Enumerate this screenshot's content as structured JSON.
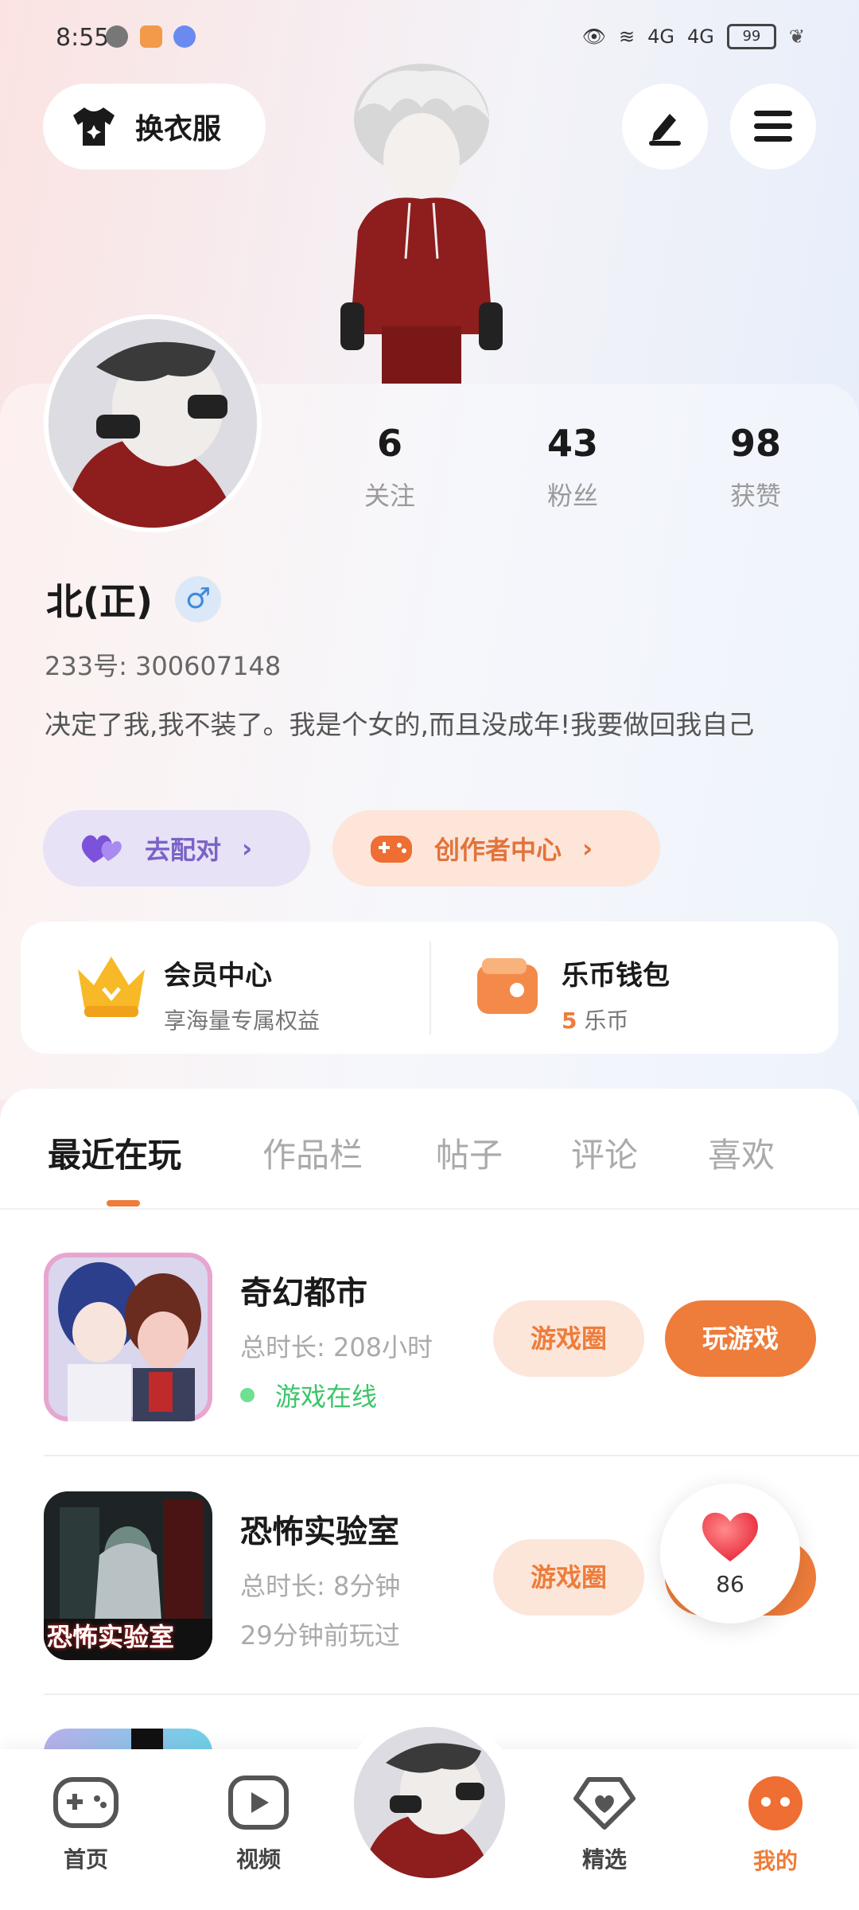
{
  "status_bar": {
    "time": "8:55",
    "battery": "99",
    "signal_1": "4G",
    "signal_2": "4G"
  },
  "top_actions": {
    "outfit_label": "换衣服"
  },
  "profile": {
    "stats": [
      {
        "value": "6",
        "label": "关注"
      },
      {
        "value": "43",
        "label": "粉丝"
      },
      {
        "value": "98",
        "label": "获赞"
      }
    ],
    "name": "北(正)",
    "gender_symbol": "♂",
    "uid": "233号: 300607148",
    "bio": "决定了我,我不装了。我是个女的,而且没成年!我要做回我自己",
    "match_label": "去配对",
    "creator_label": "创作者中心"
  },
  "member": {
    "vip_title": "会员中心",
    "vip_sub": "享海量专属权益",
    "wallet_title": "乐币钱包",
    "wallet_amount": "5",
    "wallet_unit": "乐币"
  },
  "tabs": [
    {
      "label": "最近在玩"
    },
    {
      "label": "作品栏"
    },
    {
      "label": "帖子"
    },
    {
      "label": "评论"
    },
    {
      "label": "喜欢"
    }
  ],
  "games": [
    {
      "title": "奇幻都市",
      "duration": "总时长: 208小时",
      "status": "游戏在线",
      "circle_label": "游戏圈",
      "play_label": "玩游戏"
    },
    {
      "title": "恐怖实验室",
      "duration": "总时长: 8分钟",
      "status": "29分钟前玩过",
      "circle_label": "游戏圈",
      "icon_text": "恐怖实验室"
    }
  ],
  "like": {
    "count": "86"
  },
  "nav": [
    {
      "label": "首页"
    },
    {
      "label": "视频"
    },
    {
      "label": "精选"
    },
    {
      "label": "我的"
    }
  ],
  "colors": {
    "accent": "#ee7c3a",
    "match_bg": "#e7e2f6",
    "creator_bg": "#fde5da",
    "online": "#3cc56a"
  }
}
